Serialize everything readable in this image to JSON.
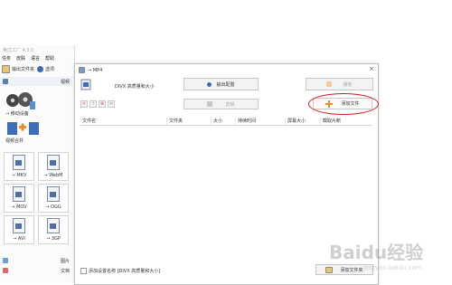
{
  "app": {
    "title": "格式工厂 4.5.0",
    "menu": [
      "任务",
      "皮肤",
      "语言",
      "帮助"
    ],
    "toolbar": {
      "output_folder": "输出文件夹",
      "options": "选项"
    },
    "categories": {
      "video": "视频",
      "picture": "图片",
      "document": "文档"
    },
    "tiles": {
      "mobile": "→ 移动设备",
      "merge": "视频合并"
    },
    "formats": [
      "→ MKV",
      "→ WebM",
      "→ MOV",
      "→ OGG",
      "→ AVI",
      "→ 3GP"
    ]
  },
  "dialog": {
    "title": "→ MP4",
    "profile": "DIVX 高质量和大小",
    "output_config": "输出配置",
    "clip": "剪辑",
    "play": "播放",
    "add_file": "添加文件",
    "columns": [
      "文件名",
      "文件夹",
      "大小",
      "持续时间",
      "屏幕大小",
      "截取片断"
    ],
    "append_setting": "添加设置名称 [DIVX 高质量和大小]",
    "add_folder": "添加文件夹"
  },
  "watermark": {
    "text": "Baidu经验",
    "sub": "jingyan.baidu.com"
  },
  "colors": {
    "highlight": "#d01a1a",
    "add_icon": "#f08a24"
  }
}
